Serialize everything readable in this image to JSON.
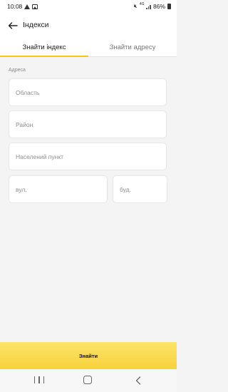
{
  "status_bar": {
    "time": "10:08",
    "network": "4G",
    "battery": "86%",
    "icons": [
      "warning-icon",
      "image-icon",
      "mute-icon",
      "signal-icon",
      "battery-icon"
    ]
  },
  "header": {
    "title": "Індекси",
    "back_icon": "arrow-left-icon"
  },
  "tabs": [
    {
      "label": "Знайти індекс",
      "active": true
    },
    {
      "label": "Знайти адресу",
      "active": false
    }
  ],
  "form": {
    "section_label": "Адреса",
    "fields": {
      "region": {
        "placeholder": "Область",
        "value": ""
      },
      "district": {
        "placeholder": "Район",
        "value": ""
      },
      "city": {
        "placeholder": "Населений пункт",
        "value": ""
      },
      "street": {
        "placeholder": "вул.",
        "value": ""
      },
      "house": {
        "placeholder": "буд.",
        "value": ""
      }
    }
  },
  "search_button_label": "Знайти",
  "nav_bar": {
    "icons": [
      "recent-apps-icon",
      "home-icon",
      "back-icon"
    ]
  },
  "colors": {
    "accent": "#f5c518",
    "button": "#f9d23b",
    "background": "#f4f4f4"
  }
}
